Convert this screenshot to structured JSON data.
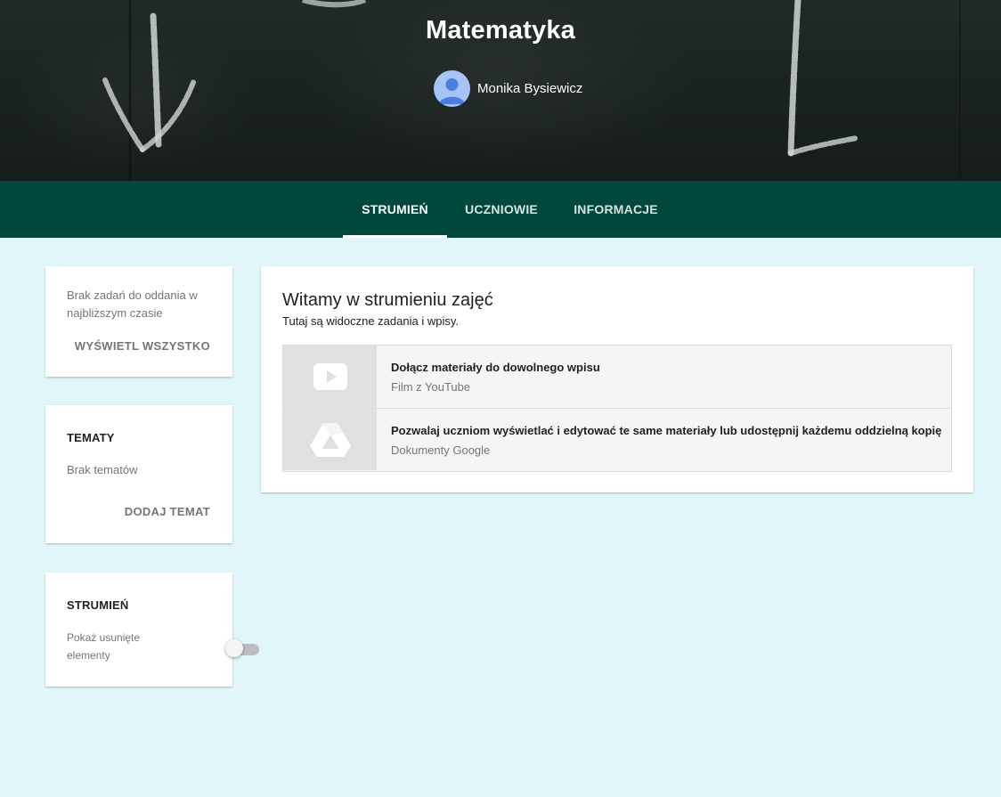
{
  "header": {
    "class_title": "Matematyka",
    "teacher_name": "Monika Bysiewicz"
  },
  "tabs": [
    {
      "label": "STRUMIEŃ",
      "active": true
    },
    {
      "label": "UCZNIOWIE",
      "active": false
    },
    {
      "label": "INFORMACJE",
      "active": false
    }
  ],
  "upcoming": {
    "text": "Brak zadań do oddania w najbliższym czasie",
    "action": "WYŚWIETL WSZYSTKO"
  },
  "topics": {
    "heading": "TEMATY",
    "empty_text": "Brak tematów",
    "action": "DODAJ TEMAT"
  },
  "stream_settings": {
    "heading": "STRUMIEŃ",
    "toggle_label": "Pokaż usunięte elementy",
    "toggle_on": false
  },
  "welcome": {
    "title": "Witamy w strumieniu zajęć",
    "subtitle": "Tutaj są widoczne zadania i wpisy.",
    "items": [
      {
        "icon": "youtube-play-icon",
        "title": "Dołącz materiały do dowolnego wpisu",
        "desc": "Film z YouTube"
      },
      {
        "icon": "google-drive-icon",
        "title": "Pozwalaj uczniom wyświetlać i edytować te same materiały lub udostępnij każdemu oddzielną kopię",
        "desc": "Dokumenty Google"
      }
    ]
  },
  "colors": {
    "tab_bar": "#00483b",
    "page_background": "#e0f6f8",
    "avatar": "#a7c4f6"
  }
}
